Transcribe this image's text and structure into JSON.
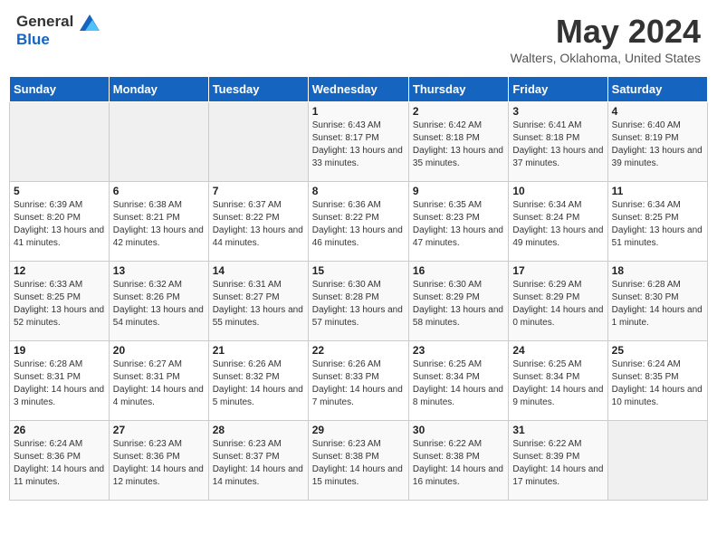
{
  "header": {
    "logo_line1": "General",
    "logo_line2": "Blue",
    "month": "May 2024",
    "location": "Walters, Oklahoma, United States"
  },
  "weekdays": [
    "Sunday",
    "Monday",
    "Tuesday",
    "Wednesday",
    "Thursday",
    "Friday",
    "Saturday"
  ],
  "weeks": [
    [
      {
        "day": "",
        "detail": ""
      },
      {
        "day": "",
        "detail": ""
      },
      {
        "day": "",
        "detail": ""
      },
      {
        "day": "1",
        "detail": "Sunrise: 6:43 AM\nSunset: 8:17 PM\nDaylight: 13 hours and 33 minutes."
      },
      {
        "day": "2",
        "detail": "Sunrise: 6:42 AM\nSunset: 8:18 PM\nDaylight: 13 hours and 35 minutes."
      },
      {
        "day": "3",
        "detail": "Sunrise: 6:41 AM\nSunset: 8:18 PM\nDaylight: 13 hours and 37 minutes."
      },
      {
        "day": "4",
        "detail": "Sunrise: 6:40 AM\nSunset: 8:19 PM\nDaylight: 13 hours and 39 minutes."
      }
    ],
    [
      {
        "day": "5",
        "detail": "Sunrise: 6:39 AM\nSunset: 8:20 PM\nDaylight: 13 hours and 41 minutes."
      },
      {
        "day": "6",
        "detail": "Sunrise: 6:38 AM\nSunset: 8:21 PM\nDaylight: 13 hours and 42 minutes."
      },
      {
        "day": "7",
        "detail": "Sunrise: 6:37 AM\nSunset: 8:22 PM\nDaylight: 13 hours and 44 minutes."
      },
      {
        "day": "8",
        "detail": "Sunrise: 6:36 AM\nSunset: 8:22 PM\nDaylight: 13 hours and 46 minutes."
      },
      {
        "day": "9",
        "detail": "Sunrise: 6:35 AM\nSunset: 8:23 PM\nDaylight: 13 hours and 47 minutes."
      },
      {
        "day": "10",
        "detail": "Sunrise: 6:34 AM\nSunset: 8:24 PM\nDaylight: 13 hours and 49 minutes."
      },
      {
        "day": "11",
        "detail": "Sunrise: 6:34 AM\nSunset: 8:25 PM\nDaylight: 13 hours and 51 minutes."
      }
    ],
    [
      {
        "day": "12",
        "detail": "Sunrise: 6:33 AM\nSunset: 8:25 PM\nDaylight: 13 hours and 52 minutes."
      },
      {
        "day": "13",
        "detail": "Sunrise: 6:32 AM\nSunset: 8:26 PM\nDaylight: 13 hours and 54 minutes."
      },
      {
        "day": "14",
        "detail": "Sunrise: 6:31 AM\nSunset: 8:27 PM\nDaylight: 13 hours and 55 minutes."
      },
      {
        "day": "15",
        "detail": "Sunrise: 6:30 AM\nSunset: 8:28 PM\nDaylight: 13 hours and 57 minutes."
      },
      {
        "day": "16",
        "detail": "Sunrise: 6:30 AM\nSunset: 8:29 PM\nDaylight: 13 hours and 58 minutes."
      },
      {
        "day": "17",
        "detail": "Sunrise: 6:29 AM\nSunset: 8:29 PM\nDaylight: 14 hours and 0 minutes."
      },
      {
        "day": "18",
        "detail": "Sunrise: 6:28 AM\nSunset: 8:30 PM\nDaylight: 14 hours and 1 minute."
      }
    ],
    [
      {
        "day": "19",
        "detail": "Sunrise: 6:28 AM\nSunset: 8:31 PM\nDaylight: 14 hours and 3 minutes."
      },
      {
        "day": "20",
        "detail": "Sunrise: 6:27 AM\nSunset: 8:31 PM\nDaylight: 14 hours and 4 minutes."
      },
      {
        "day": "21",
        "detail": "Sunrise: 6:26 AM\nSunset: 8:32 PM\nDaylight: 14 hours and 5 minutes."
      },
      {
        "day": "22",
        "detail": "Sunrise: 6:26 AM\nSunset: 8:33 PM\nDaylight: 14 hours and 7 minutes."
      },
      {
        "day": "23",
        "detail": "Sunrise: 6:25 AM\nSunset: 8:34 PM\nDaylight: 14 hours and 8 minutes."
      },
      {
        "day": "24",
        "detail": "Sunrise: 6:25 AM\nSunset: 8:34 PM\nDaylight: 14 hours and 9 minutes."
      },
      {
        "day": "25",
        "detail": "Sunrise: 6:24 AM\nSunset: 8:35 PM\nDaylight: 14 hours and 10 minutes."
      }
    ],
    [
      {
        "day": "26",
        "detail": "Sunrise: 6:24 AM\nSunset: 8:36 PM\nDaylight: 14 hours and 11 minutes."
      },
      {
        "day": "27",
        "detail": "Sunrise: 6:23 AM\nSunset: 8:36 PM\nDaylight: 14 hours and 12 minutes."
      },
      {
        "day": "28",
        "detail": "Sunrise: 6:23 AM\nSunset: 8:37 PM\nDaylight: 14 hours and 14 minutes."
      },
      {
        "day": "29",
        "detail": "Sunrise: 6:23 AM\nSunset: 8:38 PM\nDaylight: 14 hours and 15 minutes."
      },
      {
        "day": "30",
        "detail": "Sunrise: 6:22 AM\nSunset: 8:38 PM\nDaylight: 14 hours and 16 minutes."
      },
      {
        "day": "31",
        "detail": "Sunrise: 6:22 AM\nSunset: 8:39 PM\nDaylight: 14 hours and 17 minutes."
      },
      {
        "day": "",
        "detail": ""
      }
    ]
  ]
}
